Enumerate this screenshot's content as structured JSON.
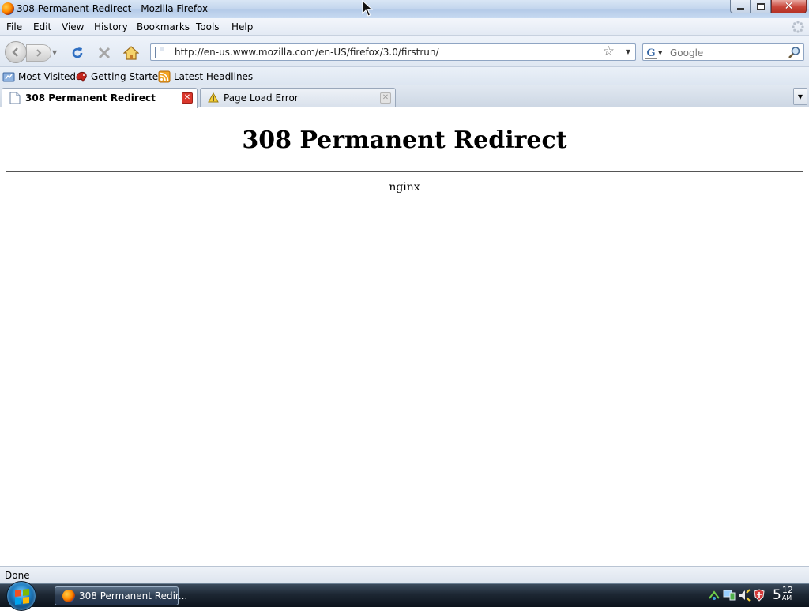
{
  "window": {
    "title": "308 Permanent Redirect - Mozilla Firefox"
  },
  "menu": {
    "items": [
      "File",
      "Edit",
      "View",
      "History",
      "Bookmarks",
      "Tools",
      "Help"
    ]
  },
  "navbar": {
    "url": "http://en-us.www.mozilla.com/en-US/firefox/3.0/firstrun/",
    "search_placeholder": "Google"
  },
  "bookmarks": {
    "items": [
      "Most Visited",
      "Getting Started",
      "Latest Headlines"
    ]
  },
  "tabs": [
    {
      "label": "308 Permanent Redirect",
      "active": true
    },
    {
      "label": "Page Load Error",
      "active": false
    }
  ],
  "page": {
    "heading": "308 Permanent Redirect",
    "server": "nginx"
  },
  "statusbar": {
    "text": "Done"
  },
  "taskbar": {
    "task_label": "308 Permanent Redir...",
    "clock": {
      "hour": "5",
      "minute": "12",
      "ampm": "AM"
    }
  },
  "colors": {
    "close_button": "#c9463a",
    "tab_close_active": "#d9362b",
    "reload_icon": "#2f6fc2"
  }
}
